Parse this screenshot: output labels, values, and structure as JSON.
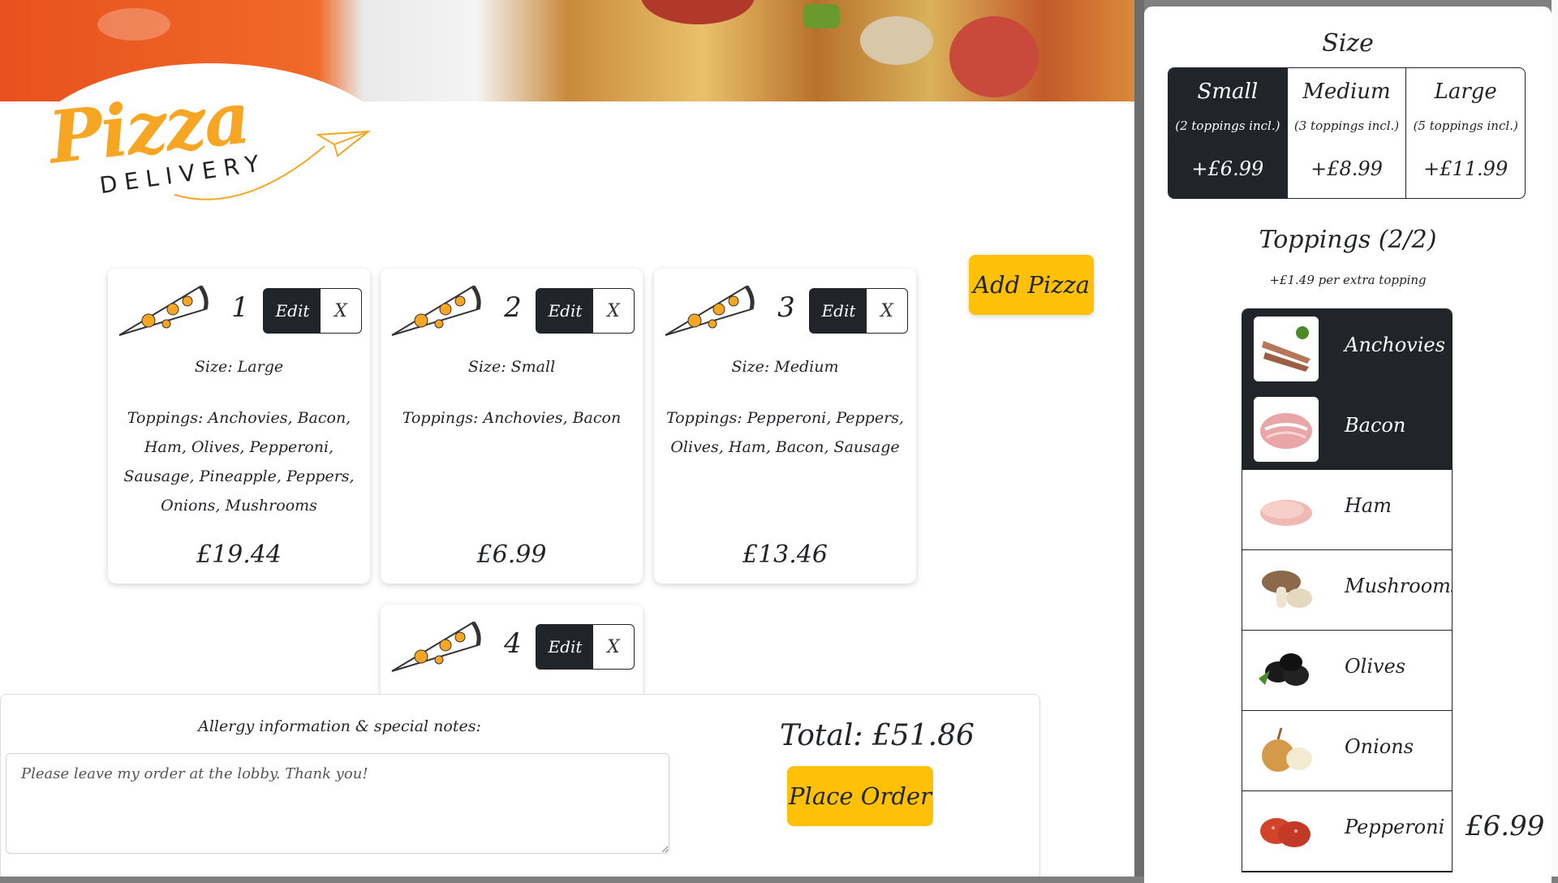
{
  "brand": {
    "word": "Pizza",
    "sub": "DELIVERY"
  },
  "cards": [
    {
      "number": "1",
      "edit": "Edit",
      "remove": "X",
      "size": "Size: Large",
      "toppings": "Toppings: Anchovies, Bacon, Ham, Olives, Pepperoni, Sausage, Pineapple, Peppers, Onions, Mushrooms",
      "price": "£19.44"
    },
    {
      "number": "2",
      "edit": "Edit",
      "remove": "X",
      "size": "Size: Small",
      "toppings": "Toppings: Anchovies, Bacon",
      "price": "£6.99"
    },
    {
      "number": "3",
      "edit": "Edit",
      "remove": "X",
      "size": "Size: Medium",
      "toppings": "Toppings: Pepperoni, Peppers, Olives, Ham, Bacon, Sausage",
      "price": "£13.46"
    },
    {
      "number": "4",
      "edit": "Edit",
      "remove": "X"
    }
  ],
  "add_button": "Add Pizza",
  "order": {
    "notes_label": "Allergy information & special notes:",
    "notes_value": "Please leave my order at the lobby. Thank you!",
    "total": "Total: £51.86",
    "place_button": "Place Order"
  },
  "panel": {
    "size_title": "Size",
    "sizes": [
      {
        "name": "Small",
        "included": "(2 toppings incl.)",
        "price": "+£6.99",
        "selected": true
      },
      {
        "name": "Medium",
        "included": "(3 toppings incl.)",
        "price": "+£8.99",
        "selected": false
      },
      {
        "name": "Large",
        "included": "(5 toppings incl.)",
        "price": "+£11.99",
        "selected": false
      }
    ],
    "toppings_title": "Toppings (2/2)",
    "toppings_sub": "+£1.49 per extra topping",
    "toppings": [
      {
        "name": "Anchovies",
        "selected": true,
        "icon": "anchovies-icon",
        "color": "#b5765a"
      },
      {
        "name": "Bacon",
        "selected": true,
        "icon": "bacon-icon",
        "color": "#e9a6a6"
      },
      {
        "name": "Ham",
        "selected": false,
        "icon": "ham-icon",
        "color": "#f0b9b4"
      },
      {
        "name": "Mushrooms",
        "selected": false,
        "icon": "mushroom-icon",
        "color": "#8a6a4a"
      },
      {
        "name": "Olives",
        "selected": false,
        "icon": "olive-icon",
        "color": "#1a1a1a"
      },
      {
        "name": "Onions",
        "selected": false,
        "icon": "onion-icon",
        "color": "#d49a4a"
      },
      {
        "name": "Pepperoni",
        "selected": false,
        "icon": "pepperoni-icon",
        "color": "#d3432c"
      }
    ],
    "price": "£6.99"
  },
  "colors": {
    "accent": "#ffc107",
    "dark": "#212529",
    "brand": "#f6a623"
  }
}
